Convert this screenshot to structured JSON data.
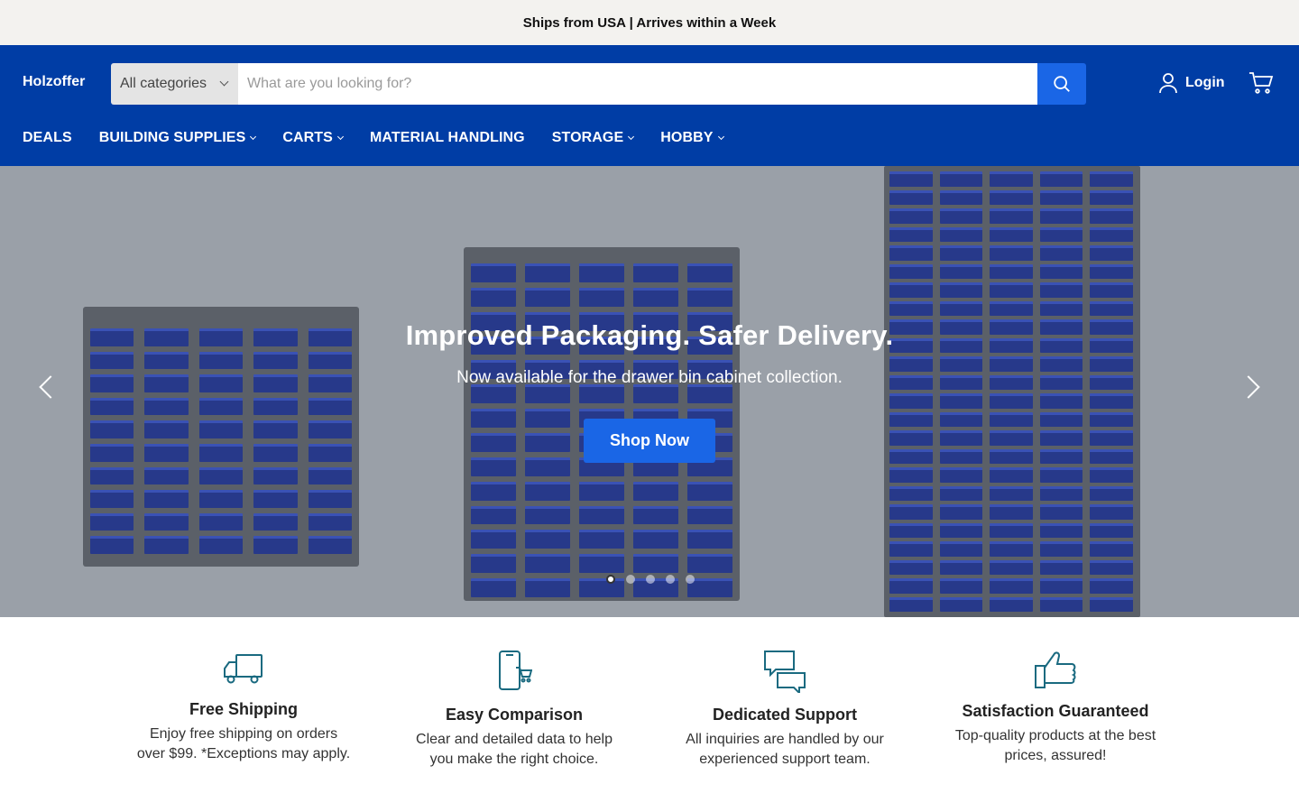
{
  "announcement": "Ships from USA | Arrives within a Week",
  "header": {
    "logo": "Holzoffer",
    "search": {
      "category": "All categories",
      "placeholder": "What are you looking for?"
    },
    "login": "Login"
  },
  "nav": [
    {
      "label": "DEALS",
      "dropdown": false
    },
    {
      "label": "BUILDING SUPPLIES",
      "dropdown": true
    },
    {
      "label": "CARTS",
      "dropdown": true
    },
    {
      "label": "MATERIAL HANDLING",
      "dropdown": false
    },
    {
      "label": "STORAGE",
      "dropdown": true
    },
    {
      "label": "HOBBY",
      "dropdown": true
    }
  ],
  "hero": {
    "title": "Improved Packaging. Safer Delivery.",
    "subtitle": "Now available for the drawer bin cabinet collection.",
    "button": "Shop Now",
    "slides": 5,
    "active_slide": 1
  },
  "features": [
    {
      "icon": "truck-icon",
      "title": "Free Shipping",
      "desc": "Enjoy free shipping on orders over $99. *Exceptions may apply."
    },
    {
      "icon": "phone-cart-icon",
      "title": "Easy Comparison",
      "desc": "Clear and detailed data to help you make the right choice."
    },
    {
      "icon": "chat-bubbles-icon",
      "title": "Dedicated Support",
      "desc": "All inquiries are handled by our experienced support team."
    },
    {
      "icon": "thumbs-up-icon",
      "title": "Satisfaction Guaranteed",
      "desc": "Top-quality products at the best prices, assured!"
    }
  ],
  "colors": {
    "brand": "#003da5",
    "accent": "#1a66e6",
    "icon": "#1a6a80"
  }
}
